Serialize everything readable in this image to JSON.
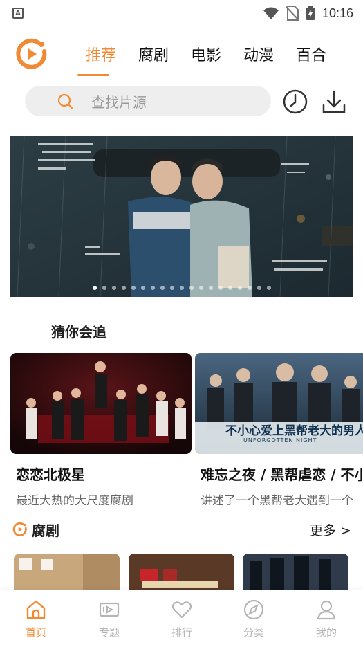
{
  "status_bar": {
    "time": "10:16",
    "notification_icon": "A"
  },
  "header": {
    "tabs": [
      "推荐",
      "腐剧",
      "电影",
      "动漫",
      "百合"
    ],
    "active_tab": 0
  },
  "search": {
    "placeholder": "查找片源"
  },
  "banner": {
    "dot_count": 19,
    "active_dot": 0
  },
  "guess": {
    "title": "猜你会追",
    "cards": [
      {
        "title": "恋恋北极星",
        "desc": "最近大热的大尺度腐剧"
      },
      {
        "title": "难忘之夜 / 黑帮虐恋 / 不小心爱上黑帮老大",
        "desc": "讲述了一个黑帮老大遇到一个"
      }
    ],
    "poster_text": "不小心爱上黑帮老大的男人",
    "poster_sub": "UNFORGOTTEN NIGHT"
  },
  "bl_section": {
    "title": "腐剧",
    "more": "更多 >"
  },
  "bottom_nav": {
    "items": [
      {
        "label": "首页",
        "icon": "home-icon"
      },
      {
        "label": "专题",
        "icon": "topic-icon"
      },
      {
        "label": "排行",
        "icon": "heart-icon"
      },
      {
        "label": "分类",
        "icon": "compass-icon"
      },
      {
        "label": "我的",
        "icon": "user-icon"
      }
    ],
    "active": 0
  },
  "colors": {
    "accent": "#f08a35",
    "inactive": "#b5b5b5"
  }
}
